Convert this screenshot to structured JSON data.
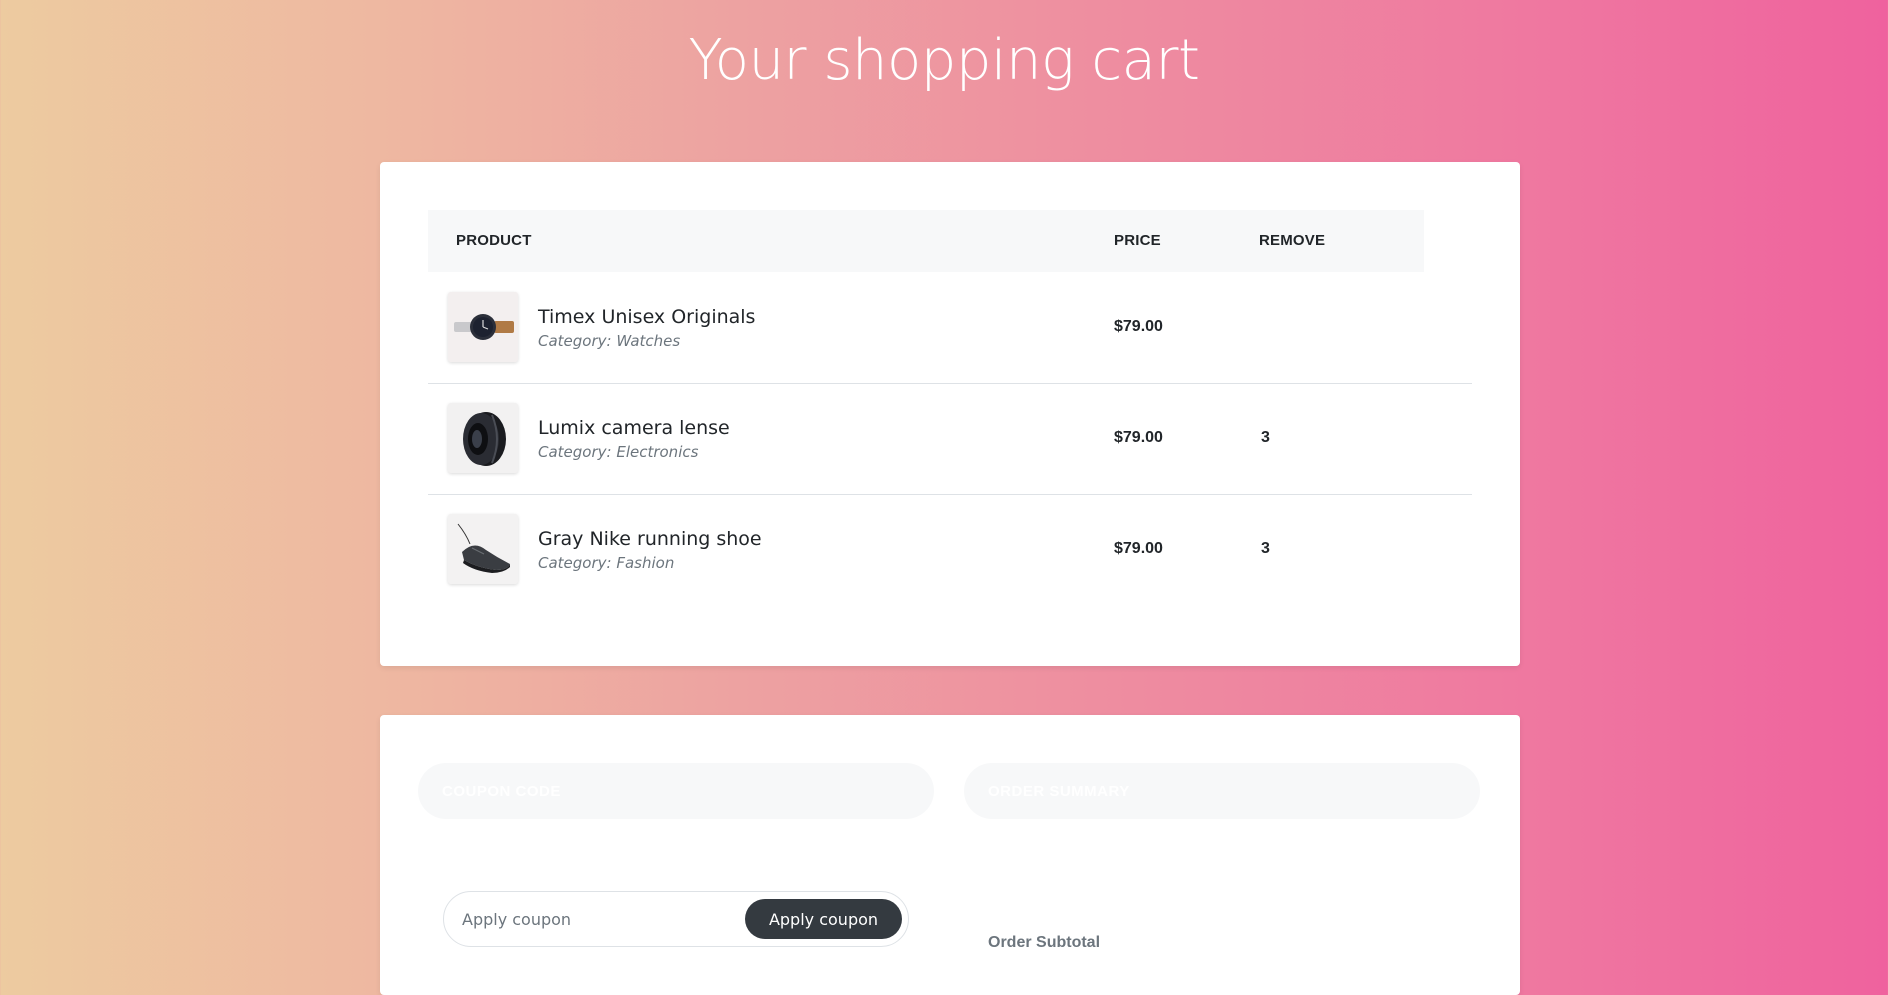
{
  "page": {
    "title": "Your shopping cart"
  },
  "cart": {
    "columns": {
      "product": "PRODUCT",
      "price": "PRICE",
      "remove": "REMOVE"
    },
    "items": [
      {
        "name": "Timex Unisex Originals",
        "category": "Category: Watches",
        "price": "$79.00",
        "quantity": "",
        "image": "watch-image"
      },
      {
        "name": "Lumix camera lense",
        "category": "Category: Electronics",
        "price": "$79.00",
        "quantity": "3",
        "image": "camera-lens-image"
      },
      {
        "name": "Gray Nike running shoe",
        "category": "Category: Fashion",
        "price": "$79.00",
        "quantity": "3",
        "image": "running-shoe-image"
      }
    ]
  },
  "coupon": {
    "heading": "COUPON CODE",
    "placeholder": "Apply coupon",
    "button_label": "Apply coupon"
  },
  "summary": {
    "heading": "ORDER SUMMARY",
    "subtotal_label": "Order Subtotal"
  },
  "colors": {
    "gradient_start": "#edcba0",
    "gradient_end": "#ef629e",
    "button_dark": "#343a40"
  }
}
